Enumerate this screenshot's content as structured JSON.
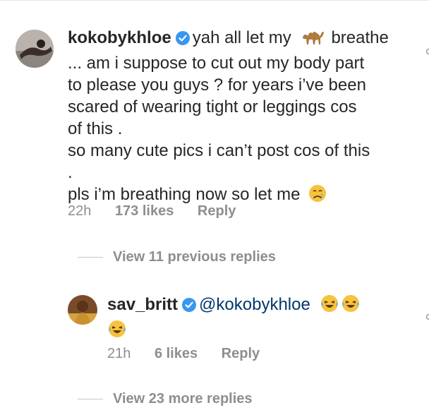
{
  "comment1": {
    "username": "kokobykhloe",
    "lines": [
      "yah all let my",
      "breathe",
      "... am i suppose to cut out my body part",
      "to please you guys ? for years i’ve been",
      "scared of wearing tight or leggings cos",
      "of this .",
      "so many cute pics i can’t post cos of this",
      ".",
      "pls i’m breathing now so let me"
    ],
    "time": "22h",
    "likes": "173 likes",
    "reply": "Reply"
  },
  "view_previous": "View 11 previous replies",
  "comment2": {
    "username": "sav_britt",
    "mention": "@kokobykhloe",
    "time": "21h",
    "likes": "6 likes",
    "reply": "Reply"
  },
  "view_more": "View 23 more replies",
  "colors": {
    "verified": "#3897f0",
    "muted": "#8e8e8e",
    "mention": "#00376b"
  },
  "icons": [
    "verified-icon",
    "camel-emoji",
    "crying-face-emoji",
    "tears-of-joy-emoji",
    "like-heart-icon"
  ]
}
